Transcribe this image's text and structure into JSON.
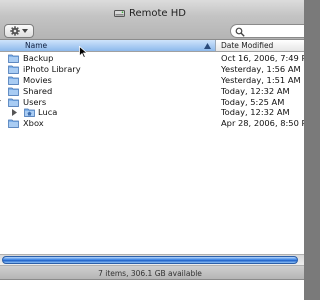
{
  "window": {
    "title": "Remote HD"
  },
  "toolbar": {
    "action_icon": "gear-icon",
    "search_placeholder": ""
  },
  "columns": {
    "name": "Name",
    "date_modified": "Date Modified",
    "sort_direction": "ascending"
  },
  "rows": [
    {
      "name": "Backup",
      "date": "Oct 16, 2006, 7:49 PM",
      "indent": 0,
      "expanded": false
    },
    {
      "name": "iPhoto Library",
      "date": "Yesterday, 1:56 AM",
      "indent": 0,
      "expanded": false
    },
    {
      "name": "Movies",
      "date": "Yesterday, 1:51 AM",
      "indent": 0,
      "expanded": false
    },
    {
      "name": "Shared",
      "date": "Today, 12:32 AM",
      "indent": 0,
      "expanded": false
    },
    {
      "name": "Users",
      "date": "Today, 5:25 AM",
      "indent": 0,
      "expanded": true
    },
    {
      "name": "Luca",
      "date": "Today, 12:32 AM",
      "indent": 1,
      "expanded": false
    },
    {
      "name": "Xbox",
      "date": "Apr 28, 2006, 8:50 PM",
      "indent": 0,
      "expanded": false
    }
  ],
  "status": {
    "text": "7 items, 306.1 GB available"
  },
  "colors": {
    "selected_column": "#8db9ec",
    "scroll_thumb": "#3f86e6",
    "folder": "#6aa3e6"
  }
}
